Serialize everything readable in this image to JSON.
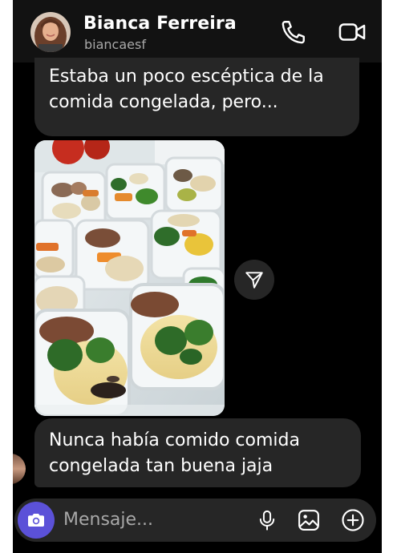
{
  "header": {
    "contact_name": "Bianca Ferreira",
    "contact_handle": "biancaesf",
    "avatar_icon": "profile-photo"
  },
  "messages": [
    {
      "type": "text",
      "lines": [
        "Estaba un poco escéptica de la",
        "comida congelada, pero..."
      ]
    },
    {
      "type": "image",
      "icon": "meal-prep-containers-photo"
    },
    {
      "type": "text",
      "lines": [
        "Nunca había comido comida",
        "congelada tan buena jaja"
      ]
    }
  ],
  "composer": {
    "placeholder": "Mensaje..."
  },
  "colors": {
    "background": "#000000",
    "header": "#121212",
    "bubble": "#262626",
    "camera_accent": "#5b51d8",
    "secondary_text": "#a8a8a8"
  }
}
